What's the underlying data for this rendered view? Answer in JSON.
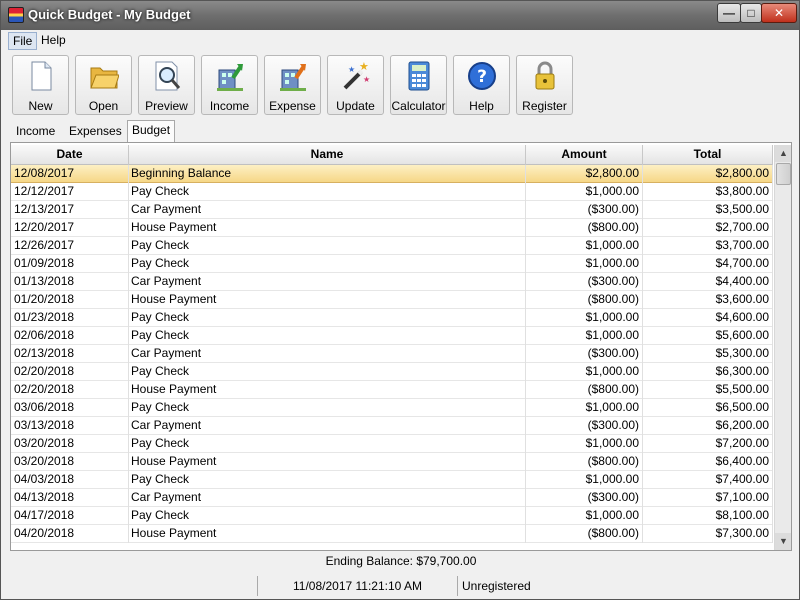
{
  "window": {
    "title": "Quick Budget - My Budget"
  },
  "menu": {
    "file": "File",
    "help": "Help"
  },
  "toolbar": {
    "buttons": [
      {
        "label": "New",
        "icon": "new-document-icon"
      },
      {
        "label": "Open",
        "icon": "open-folder-icon"
      },
      {
        "label": "Preview",
        "icon": "magnifier-preview-icon"
      },
      {
        "label": "Income",
        "icon": "income-building-arrow-icon"
      },
      {
        "label": "Expense",
        "icon": "expense-building-arrow-icon"
      },
      {
        "label": "Update",
        "icon": "magic-wand-icon"
      },
      {
        "label": "Calculator",
        "icon": "calculator-icon"
      },
      {
        "label": "Help",
        "icon": "help-question-icon"
      },
      {
        "label": "Register",
        "icon": "padlock-icon"
      }
    ]
  },
  "tabs": [
    "Income",
    "Expenses",
    "Budget"
  ],
  "active_tab": "Budget",
  "grid": {
    "columns": [
      "Date",
      "Name",
      "Amount",
      "Total"
    ],
    "rows": [
      {
        "date": "12/08/2017",
        "name": "Beginning Balance",
        "amount": "$2,800.00",
        "total": "$2,800.00"
      },
      {
        "date": "12/12/2017",
        "name": "Pay Check",
        "amount": "$1,000.00",
        "total": "$3,800.00"
      },
      {
        "date": "12/13/2017",
        "name": "Car Payment",
        "amount": "($300.00)",
        "total": "$3,500.00"
      },
      {
        "date": "12/20/2017",
        "name": "House Payment",
        "amount": "($800.00)",
        "total": "$2,700.00"
      },
      {
        "date": "12/26/2017",
        "name": "Pay Check",
        "amount": "$1,000.00",
        "total": "$3,700.00"
      },
      {
        "date": "01/09/2018",
        "name": "Pay Check",
        "amount": "$1,000.00",
        "total": "$4,700.00"
      },
      {
        "date": "01/13/2018",
        "name": "Car Payment",
        "amount": "($300.00)",
        "total": "$4,400.00"
      },
      {
        "date": "01/20/2018",
        "name": "House Payment",
        "amount": "($800.00)",
        "total": "$3,600.00"
      },
      {
        "date": "01/23/2018",
        "name": "Pay Check",
        "amount": "$1,000.00",
        "total": "$4,600.00"
      },
      {
        "date": "02/06/2018",
        "name": "Pay Check",
        "amount": "$1,000.00",
        "total": "$5,600.00"
      },
      {
        "date": "02/13/2018",
        "name": "Car Payment",
        "amount": "($300.00)",
        "total": "$5,300.00"
      },
      {
        "date": "02/20/2018",
        "name": "Pay Check",
        "amount": "$1,000.00",
        "total": "$6,300.00"
      },
      {
        "date": "02/20/2018",
        "name": "House Payment",
        "amount": "($800.00)",
        "total": "$5,500.00"
      },
      {
        "date": "03/06/2018",
        "name": "Pay Check",
        "amount": "$1,000.00",
        "total": "$6,500.00"
      },
      {
        "date": "03/13/2018",
        "name": "Car Payment",
        "amount": "($300.00)",
        "total": "$6,200.00"
      },
      {
        "date": "03/20/2018",
        "name": "Pay Check",
        "amount": "$1,000.00",
        "total": "$7,200.00"
      },
      {
        "date": "03/20/2018",
        "name": "House Payment",
        "amount": "($800.00)",
        "total": "$6,400.00"
      },
      {
        "date": "04/03/2018",
        "name": "Pay Check",
        "amount": "$1,000.00",
        "total": "$7,400.00"
      },
      {
        "date": "04/13/2018",
        "name": "Car Payment",
        "amount": "($300.00)",
        "total": "$7,100.00"
      },
      {
        "date": "04/17/2018",
        "name": "Pay Check",
        "amount": "$1,000.00",
        "total": "$8,100.00"
      },
      {
        "date": "04/20/2018",
        "name": "House Payment",
        "amount": "($800.00)",
        "total": "$7,300.00"
      }
    ]
  },
  "ending_balance": "Ending Balance: $79,700.00",
  "status": {
    "left": "",
    "datetime": "11/08/2017 11:21:10 AM",
    "registration": "Unregistered"
  },
  "colors": {
    "selected_row": "#f6d787",
    "titlebar": "#6e6e6e"
  }
}
